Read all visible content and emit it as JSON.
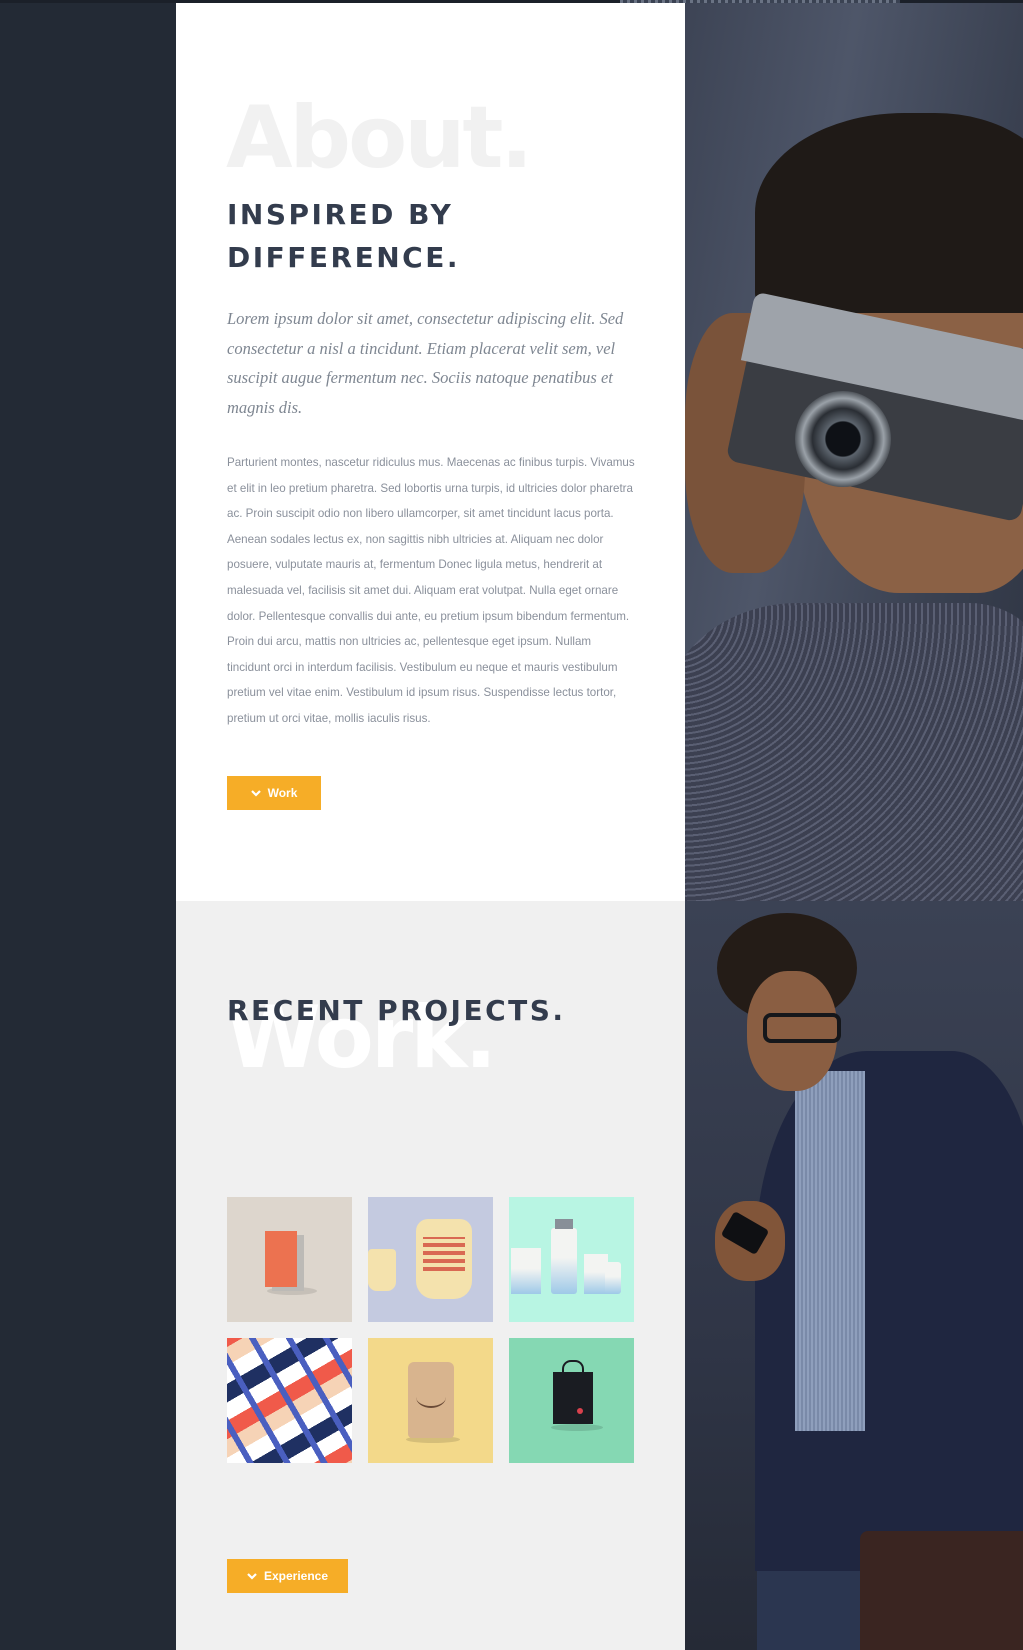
{
  "about": {
    "watermark": "About.",
    "heading": "INSPIRED BY DIFFERENCE.",
    "lead": "Lorem ipsum dolor sit amet, consectetur adipiscing elit. Sed consectetur a nisl a tincidunt. Etiam placerat velit sem, vel suscipit augue fermentum nec. Sociis natoque penatibus et magnis dis.",
    "body": "Parturient montes, nascetur ridiculus mus. Maecenas ac finibus turpis. Vivamus et elit in leo pretium pharetra. Sed lobortis urna turpis, id ultricies dolor pharetra ac. Proin suscipit odio non libero ullamcorper, sit amet tincidunt lacus porta. Aenean sodales lectus ex, non sagittis nibh ultricies at. Aliquam nec dolor posuere, vulputate mauris at, fermentum Donec ligula metus, hendrerit at malesuada vel, facilisis sit amet dui. Aliquam erat volutpat. Nulla eget ornare dolor. Pellentesque convallis dui ante, eu pretium ipsum bibendum fermentum. Proin dui arcu, mattis non ultricies ac, pellentesque eget ipsum. Nullam tincidunt orci in interdum facilisis. Vestibulum eu neque et mauris vestibulum pretium vel vitae enim. Vestibulum id ipsum risus. Suspendisse lectus tortor, pretium ut orci vitae, mollis iaculis risus.",
    "button_label": "Work",
    "button_icon": "chevron-down-icon",
    "photo": "man-with-camera-photo"
  },
  "work": {
    "watermark": "Work.",
    "heading": "RECENT PROJECTS.",
    "projects": [
      {
        "name": "packaging-box"
      },
      {
        "name": "teapot-stationery"
      },
      {
        "name": "cosmetic-bottles"
      },
      {
        "name": "business-cards"
      },
      {
        "name": "coffee-pouch"
      },
      {
        "name": "black-shopping-bag"
      }
    ],
    "button_label": "Experience",
    "button_icon": "chevron-down-icon",
    "photo": "man-with-phone-photo"
  },
  "colors": {
    "accent": "#f6ad27",
    "sidebar": "#232a35",
    "heading": "#333c4d",
    "about_bg": "#ffffff",
    "work_bg": "#f0f0f0"
  }
}
